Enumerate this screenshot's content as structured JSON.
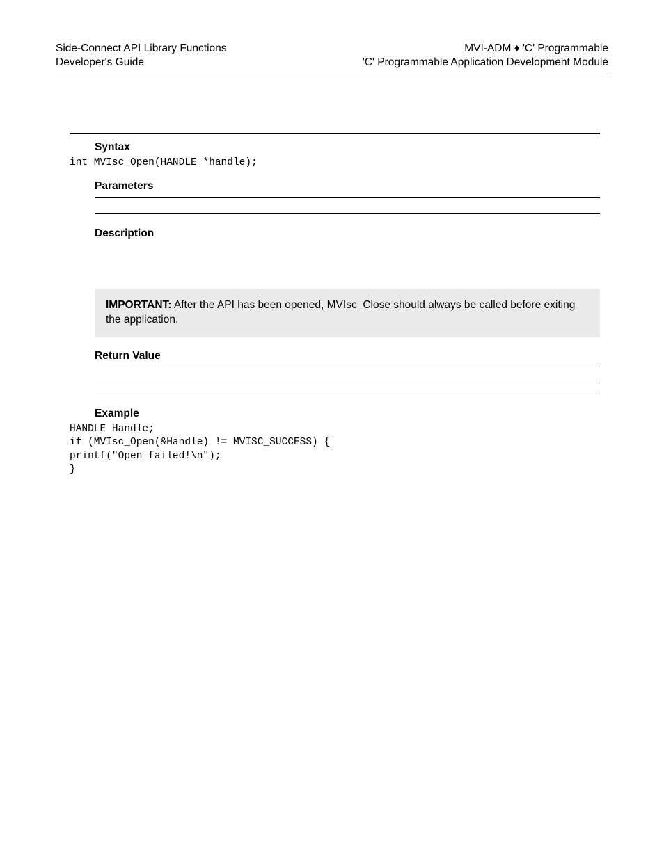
{
  "header": {
    "left_line1": "Side-Connect API Library Functions",
    "left_line2": "Developer's Guide",
    "right_line1": "MVI-ADM ♦ 'C' Programmable",
    "right_line2": "'C' Programmable Application Development Module"
  },
  "sections": {
    "syntax": {
      "heading": "Syntax",
      "code": "int MVIsc_Open(HANDLE *handle);"
    },
    "parameters": {
      "heading": "Parameters"
    },
    "description": {
      "heading": "Description"
    },
    "important": {
      "label": "IMPORTANT:",
      "text": " After the API has been opened, MVIsc_Close should always be called before exiting the application."
    },
    "return_value": {
      "heading": "Return Value"
    },
    "example": {
      "heading": "Example",
      "code": "HANDLE Handle;\nif (MVIsc_Open(&Handle) != MVISC_SUCCESS) {\nprintf(\"Open failed!\\n\");\n}"
    }
  }
}
